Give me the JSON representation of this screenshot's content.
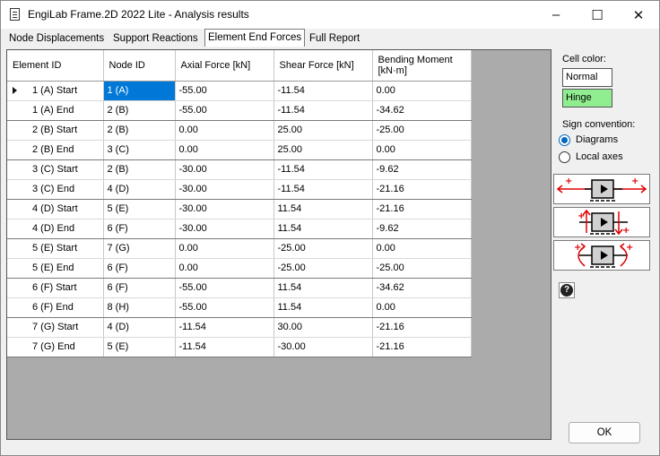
{
  "window": {
    "title": "EngiLab Frame.2D 2022 Lite - Analysis results",
    "minimize_symbol": "–",
    "maximize_symbol": "☐",
    "close_symbol": "✕"
  },
  "tabs": [
    {
      "label": "Node Displacements"
    },
    {
      "label": "Support Reactions"
    },
    {
      "label": "Element End Forces",
      "active": true
    },
    {
      "label": "Full Report"
    }
  ],
  "grid": {
    "columns": [
      "Element ID",
      "Node ID",
      "Axial Force [kN]",
      "Shear Force [kN]",
      "Bending Moment [kN·m]"
    ],
    "rows": [
      {
        "element": "1 (A) Start",
        "node": "1 (A)",
        "axial": "-55.00",
        "shear": "-11.54",
        "moment": "0.00"
      },
      {
        "element": "1 (A) End",
        "node": "2 (B)",
        "axial": "-55.00",
        "shear": "-11.54",
        "moment": "-34.62"
      },
      {
        "element": "2 (B) Start",
        "node": "2 (B)",
        "axial": "0.00",
        "shear": "25.00",
        "moment": "-25.00"
      },
      {
        "element": "2 (B) End",
        "node": "3 (C)",
        "axial": "0.00",
        "shear": "25.00",
        "moment": "0.00"
      },
      {
        "element": "3 (C) Start",
        "node": "2 (B)",
        "axial": "-30.00",
        "shear": "-11.54",
        "moment": "-9.62"
      },
      {
        "element": "3 (C) End",
        "node": "4 (D)",
        "axial": "-30.00",
        "shear": "-11.54",
        "moment": "-21.16"
      },
      {
        "element": "4 (D) Start",
        "node": "5 (E)",
        "axial": "-30.00",
        "shear": "11.54",
        "moment": "-21.16"
      },
      {
        "element": "4 (D) End",
        "node": "6 (F)",
        "axial": "-30.00",
        "shear": "11.54",
        "moment": "-9.62"
      },
      {
        "element": "5 (E) Start",
        "node": "7 (G)",
        "axial": "0.00",
        "shear": "-25.00",
        "moment": "0.00"
      },
      {
        "element": "5 (E) End",
        "node": "6 (F)",
        "axial": "0.00",
        "shear": "-25.00",
        "moment": "-25.00"
      },
      {
        "element": "6 (F) Start",
        "node": "6 (F)",
        "axial": "-55.00",
        "shear": "11.54",
        "moment": "-34.62"
      },
      {
        "element": "6 (F) End",
        "node": "8 (H)",
        "axial": "-55.00",
        "shear": "11.54",
        "moment": "0.00"
      },
      {
        "element": "7 (G) Start",
        "node": "4 (D)",
        "axial": "-11.54",
        "shear": "30.00",
        "moment": "-21.16"
      },
      {
        "element": "7 (G) End",
        "node": "5 (E)",
        "axial": "-11.54",
        "shear": "-30.00",
        "moment": "-21.16"
      }
    ],
    "selected_cell": {
      "row": 0,
      "column": "node"
    }
  },
  "side_panel": {
    "cell_color_label": "Cell color:",
    "normal_label": "Normal",
    "hinge_label": "Hinge",
    "hinge_color": "#90ee90",
    "sign_convention_label": "Sign convention:",
    "options": [
      {
        "label": "Diagrams",
        "selected": true
      },
      {
        "label": "Local axes",
        "selected": false
      }
    ],
    "diagrams": [
      "axial-force-sign-diagram",
      "shear-force-sign-diagram",
      "bending-moment-sign-diagram"
    ],
    "help_symbol": "?",
    "ok_label": "OK"
  },
  "colors": {
    "selection": "#0078d7",
    "grid_background": "#ababab",
    "arrow_red": "#e00000",
    "radio_blue": "#0067c0"
  }
}
